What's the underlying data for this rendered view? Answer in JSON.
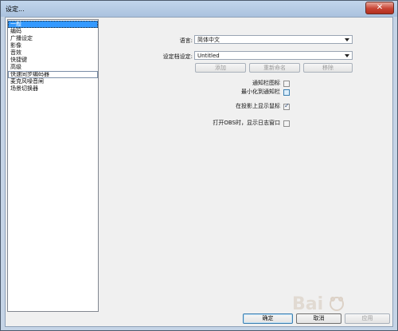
{
  "window": {
    "title": "设定..."
  },
  "sidebar": {
    "items": [
      {
        "label": "一般"
      },
      {
        "label": "编码"
      },
      {
        "label": "广播设定"
      },
      {
        "label": "影像"
      },
      {
        "label": "音效"
      },
      {
        "label": "快捷键"
      },
      {
        "label": "高级"
      },
      {
        "label": "快速同步编码器"
      },
      {
        "label": "麦克风噪音闸"
      },
      {
        "label": "场景切换器"
      }
    ],
    "selected_index": 0
  },
  "general": {
    "language_label": "语言:",
    "language_value": "简体中文",
    "profile_label": "设定档设定:",
    "profile_value": "Untitled",
    "add_label": "添加",
    "rename_label": "重新命名",
    "remove_label": "移除",
    "tray_icon_label": "通知栏图标",
    "minimize_tray_label": "最小化到通知栏",
    "show_cursor_label": "在投影上显示鼠标",
    "show_log_label": "打开OBS时，显示日志窗口"
  },
  "footer": {
    "ok_label": "确定",
    "cancel_label": "取消",
    "apply_label": "应用"
  },
  "colors": {
    "selection": "#3399ff",
    "title_bar": "#b6cbe4",
    "close_button": "#c84434"
  }
}
